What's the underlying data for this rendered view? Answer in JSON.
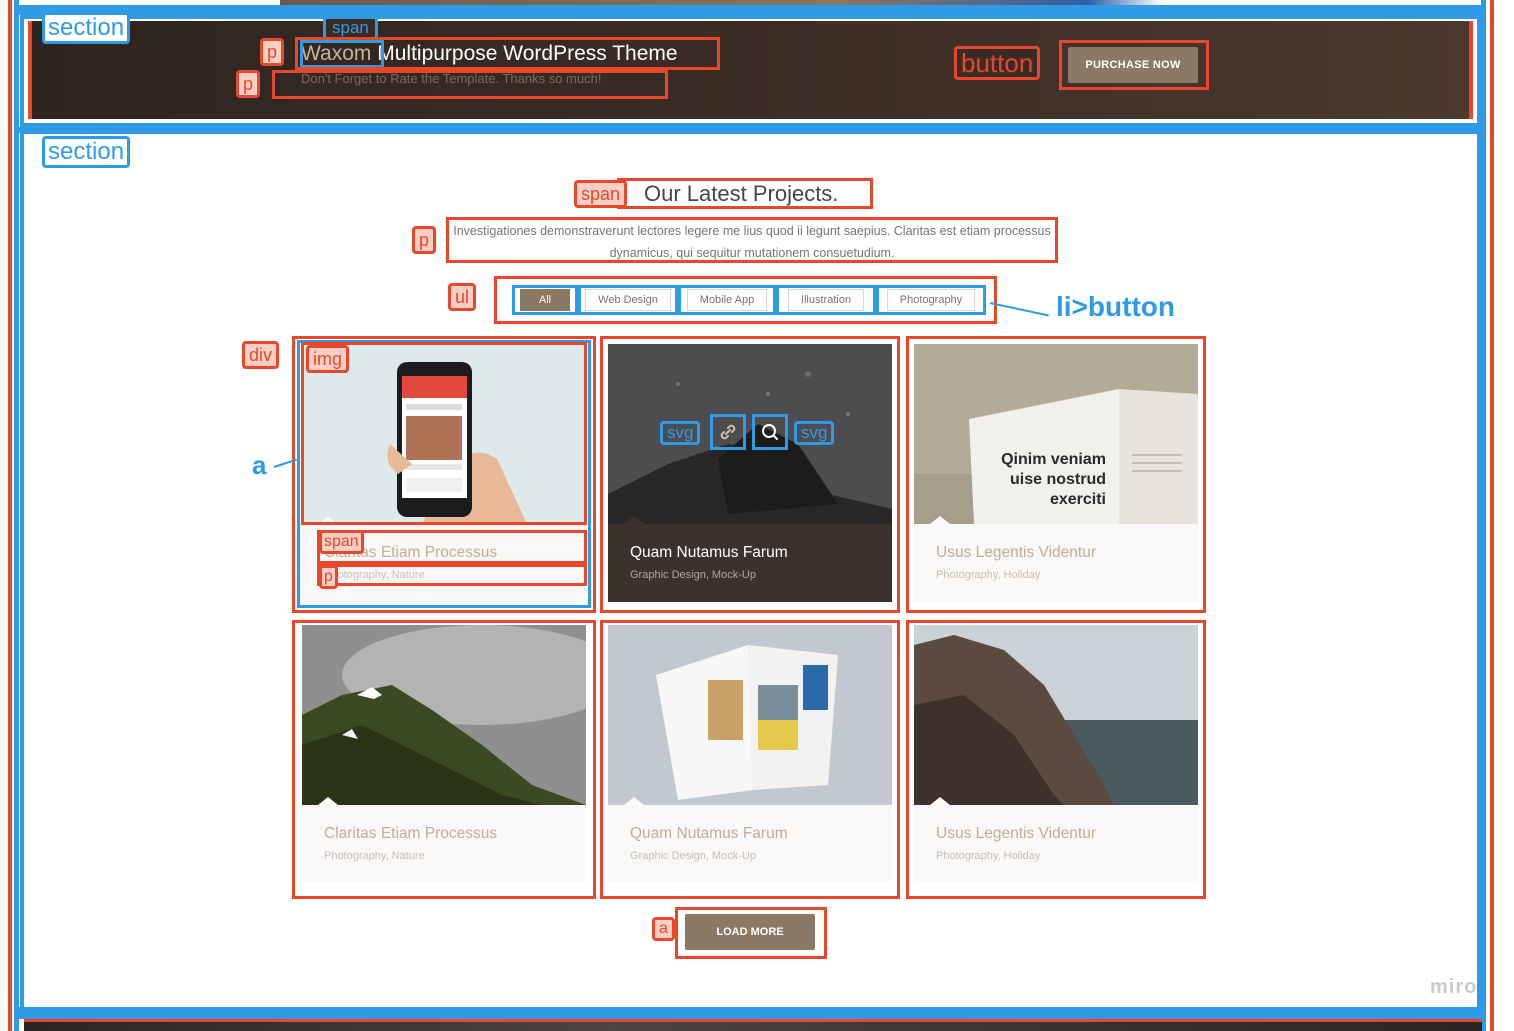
{
  "labels": {
    "section_top": "section",
    "section_projects": "section",
    "span": "span",
    "p": "p",
    "button": "button",
    "ul": "ul",
    "li_button": "li>button",
    "div": "div",
    "img": "img",
    "a": "a",
    "svg": "svg",
    "load_more_a": "a"
  },
  "banner": {
    "title_accent": "Waxom",
    "title_rest": " Multipurpose WordPress Theme",
    "subtitle": "Don't Forget to Rate the Template. Thanks so much!",
    "purchase_label": "PURCHASE NOW"
  },
  "projects": {
    "heading": "Our Latest Projects.",
    "lead": "Investigationes demonstraverunt lectores legere me lius quod ii legunt saepius. Claritas est etiam processus dynamicus, qui sequitur mutationem consuetudium.",
    "filters": [
      "All",
      "Web Design",
      "Mobile App",
      "Illustration",
      "Photography"
    ],
    "active_filter": "All",
    "cards": [
      {
        "title": "Claritas Etiam Processus",
        "category": "Photography, Nature"
      },
      {
        "title": "Quam Nutamus Farum",
        "category": "Graphic Design, Mock-Up"
      },
      {
        "title": "Usus Legentis Videntur",
        "category": "Photography, Holiday"
      },
      {
        "title": "Claritas Etiam Processus",
        "category": "Photography, Nature"
      },
      {
        "title": "Quam Nutamus Farum",
        "category": "Graphic Design, Mock-Up"
      },
      {
        "title": "Usus Legentis Videntur",
        "category": "Photography, Holiday"
      }
    ],
    "book_text": "Qinim veniam uise nostrud exerciti",
    "load_more_label": "LOAD MORE"
  },
  "watermark": "miro",
  "colors": {
    "annotation_red": "#e8472b",
    "annotation_blue": "#2f9be6",
    "brand_brown": "#8b7865",
    "banner_dark": "#3a2b24"
  }
}
